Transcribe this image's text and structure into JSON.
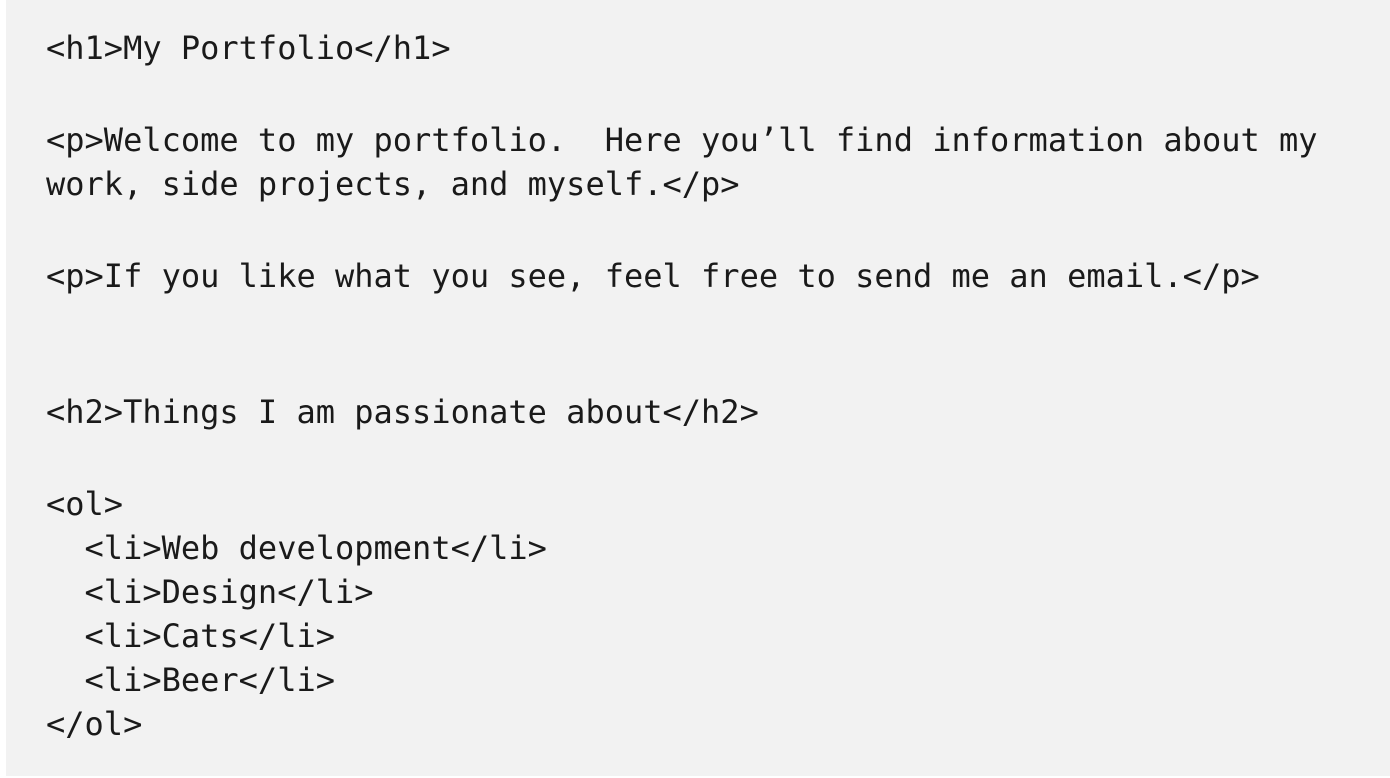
{
  "code": {
    "lines": [
      "<h1>My Portfolio</h1>",
      "<p>Welcome to my portfolio.  Here you’ll find information about my",
      "work, side projects, and myself.</p>",
      "<p>If you like what you see, feel free to send me an email.</p>",
      "<h2>Things I am passionate about</h2>",
      "<ol>",
      "  <li>Web development</li>",
      "  <li>Design</li>",
      "  <li>Cats</li>",
      "  <li>Beer</li>",
      "</ol>"
    ]
  },
  "colors": {
    "panel_background": "#f2f2f2",
    "text": "#1a1a1a"
  }
}
